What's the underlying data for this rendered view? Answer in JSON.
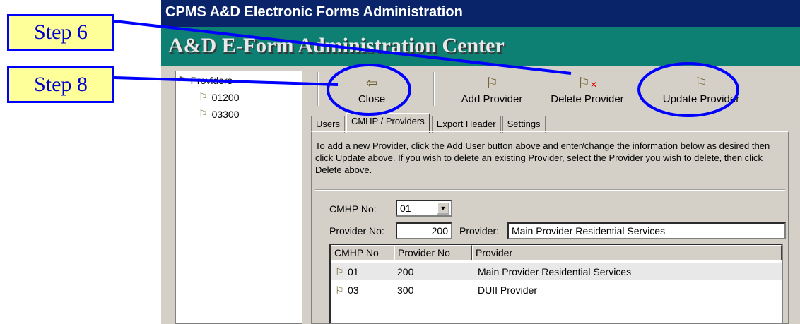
{
  "window_title": "CPMS A&D Electronic Forms Administration",
  "banner_title": "A&D E-Form Administration Center",
  "callouts": {
    "step6": "Step 6",
    "step8": "Step 8"
  },
  "tree": {
    "root": "Providers",
    "items": [
      "01200",
      "03300"
    ]
  },
  "toolbar": {
    "close": "Close",
    "add_provider": "Add Provider",
    "delete_provider": "Delete Provider",
    "update_provider": "Update Provider"
  },
  "tabs": [
    "Users",
    "CMHP / Providers",
    "Export Header",
    "Settings"
  ],
  "description": "To add a new Provider, click the Add User button above and enter/change the information below as desired then click Update above.  If you wish to delete an existing Provider, select the Provider you wish to delete, then click Delete above.",
  "form": {
    "cmhp_label": "CMHP No:",
    "cmhp_value": "01",
    "provider_no_label": "Provider No:",
    "provider_no_value": "200",
    "provider_label": "Provider:",
    "provider_value": "Main Provider Residential Services"
  },
  "table": {
    "headers": [
      "CMHP No",
      "Provider No",
      "Provider"
    ],
    "rows": [
      {
        "cmhp": "01",
        "provider_no": "200",
        "provider": "Main Provider Residential Services"
      },
      {
        "cmhp": "03",
        "provider_no": "300",
        "provider": "DUII Provider"
      }
    ]
  },
  "colors": {
    "annotation": "#0000ff",
    "callout_bg": "#ffff99",
    "title_bar": "#0a246a",
    "banner": "#0e8073"
  }
}
